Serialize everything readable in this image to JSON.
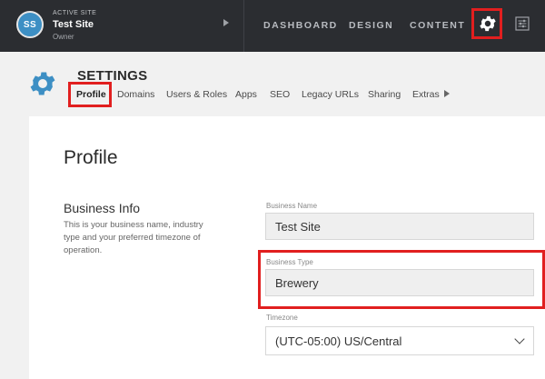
{
  "topbar": {
    "avatar_initials": "SS",
    "active_site_label": "ACTIVE SITE",
    "site_name": "Test Site",
    "site_role": "Owner",
    "nav": [
      "DASHBOARD",
      "DESIGN",
      "CONTENT"
    ],
    "gear_icon": "gear-icon",
    "panel_icon": "sliders-icon"
  },
  "settings": {
    "title": "SETTINGS",
    "tabs": [
      "Profile",
      "Domains",
      "Users & Roles",
      "Apps",
      "SEO",
      "Legacy URLs",
      "Sharing",
      "Extras"
    ]
  },
  "profile": {
    "heading": "Profile",
    "section_title": "Business Info",
    "section_desc": "This is your business name, industry type and your preferred timezone of operation.",
    "business_name_label": "Business Name",
    "business_name_value": "Test Site",
    "business_type_label": "Business Type",
    "business_type_value": "Brewery",
    "timezone_label": "Timezone",
    "timezone_value": "(UTC-05:00) US/Central"
  },
  "colors": {
    "topbar": "#2b2d31",
    "accent": "#3d8fc4",
    "highlight": "#e11f1f"
  }
}
